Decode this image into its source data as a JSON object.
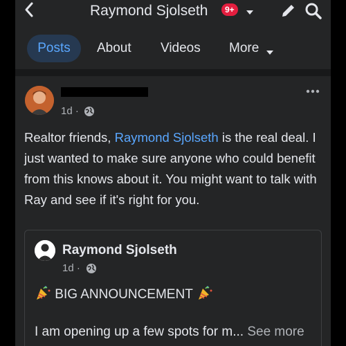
{
  "header": {
    "title": "Raymond Sjolseth",
    "badge": "9+",
    "icons": [
      "back-arrow-icon",
      "caret-down-icon",
      "pencil-icon",
      "search-icon"
    ]
  },
  "tabs": [
    {
      "label": "Posts",
      "active": true
    },
    {
      "label": "About"
    },
    {
      "label": "Videos"
    },
    {
      "label": "More"
    }
  ],
  "post": {
    "time": "1d ·",
    "text_prefix": "Realtor friends, ",
    "mention": "Raymond Sjolseth",
    "text_suffix": " is the real deal.  I just wanted to make sure anyone who could benefit from this knows about it.  You might want to talk with Ray and see if it's right for you."
  },
  "shared": {
    "author": "Raymond Sjolseth",
    "time": "1d ·",
    "headline": "BIG ANNOUNCEMENT",
    "snippet": "I am opening up a few spots for m...",
    "see_more": "See more"
  },
  "colors": {
    "background": "#242526",
    "accent": "#5aa7ff",
    "badge": "#e41e3f",
    "active_tab_bg": "#263951"
  }
}
